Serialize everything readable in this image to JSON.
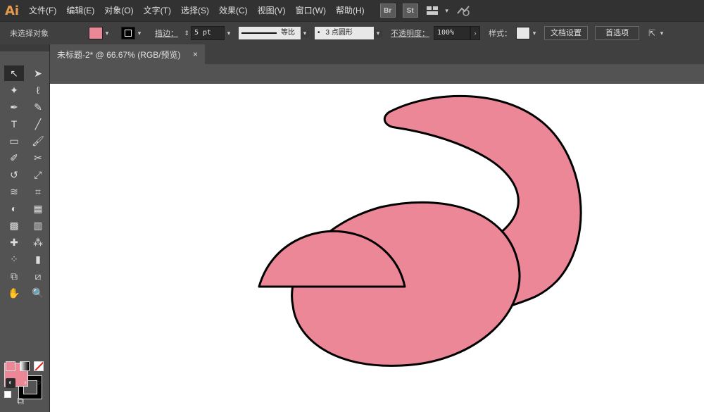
{
  "app": {
    "logo": "Ai"
  },
  "menu": [
    "文件(F)",
    "编辑(E)",
    "对象(O)",
    "文字(T)",
    "选择(S)",
    "效果(C)",
    "视图(V)",
    "窗口(W)",
    "帮助(H)"
  ],
  "app_buttons": [
    "Br",
    "St"
  ],
  "control": {
    "selection_label": "未选择对象",
    "stroke_label": "描边：",
    "stroke_value": "5 pt",
    "profile_label": "等比",
    "brush_label": "3 点圆形",
    "brush_bullet": "•",
    "opacity_label": "不透明度：",
    "opacity_value": "100%",
    "style_label": "样式：",
    "doc_settings": "文档设置",
    "preferences": "首选项"
  },
  "document_tab": {
    "title": "未标题-2* @ 66.67% (RGB/预览)",
    "close": "×"
  },
  "colors": {
    "fill": "#ec8797",
    "stroke": "#000000",
    "accent": "#e59b4b"
  },
  "tools": [
    "selection-tool",
    "direct-selection-tool",
    "magic-wand-tool",
    "lasso-tool",
    "pen-tool",
    "curvature-tool",
    "type-tool",
    "line-tool",
    "rectangle-tool",
    "paintbrush-tool",
    "shaper-tool",
    "scissors-tool",
    "rotate-tool",
    "scale-tool",
    "warp-tool",
    "free-transform-tool",
    "shape-builder-tool",
    "perspective-grid-tool",
    "mesh-tool",
    "gradient-tool",
    "eyedropper-tool",
    "blend-tool",
    "symbol-sprayer-tool",
    "column-graph-tool",
    "artboard-tool",
    "slice-tool",
    "hand-tool",
    "zoom-tool"
  ],
  "tool_glyphs": [
    "↖",
    "➤",
    "✦",
    "ℓ",
    "✒",
    "✎",
    "T",
    "╱",
    "▭",
    "🖌",
    "✐",
    "✂",
    "↺",
    "⤢",
    "≋",
    "⌗",
    "◐",
    "▦",
    "▩",
    "▥",
    "✚",
    "⁂",
    "⁘",
    "▮",
    "⧉",
    "⧄",
    "✋",
    "🔍"
  ]
}
